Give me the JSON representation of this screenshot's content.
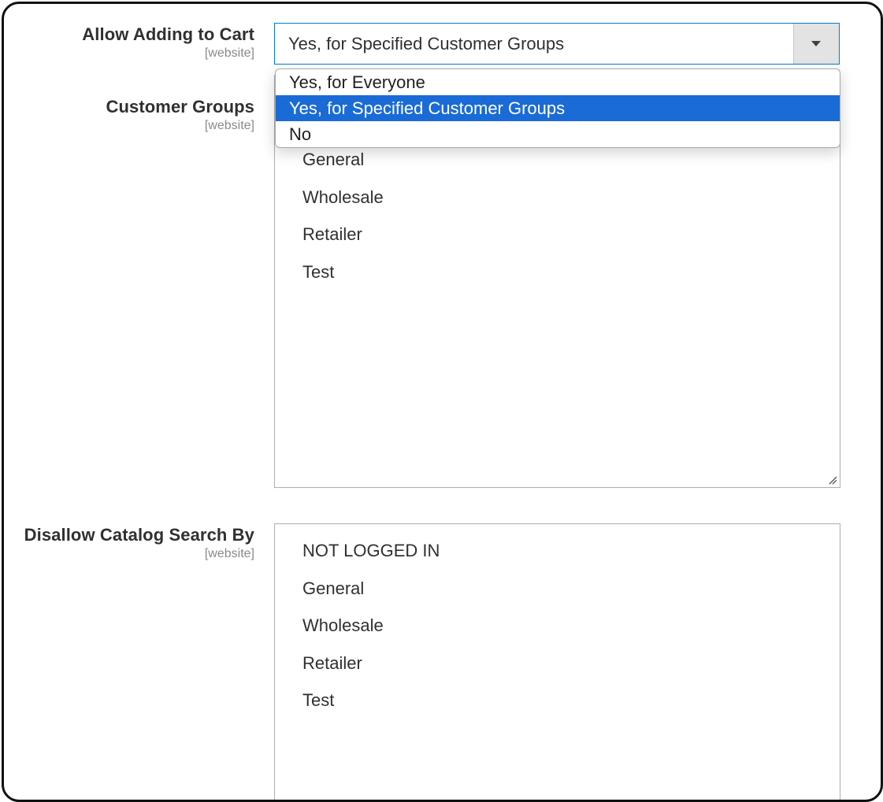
{
  "allow_adding_to_cart": {
    "label": "Allow Adding to Cart",
    "scope": "[website]",
    "selected_value": "Yes, for Specified Customer Groups",
    "options": [
      "Yes, for Everyone",
      "Yes, for Specified Customer Groups",
      "No"
    ]
  },
  "customer_groups": {
    "label": "Customer Groups",
    "scope": "[website]",
    "items": [
      "General",
      "Wholesale",
      "Retailer",
      "Test"
    ]
  },
  "disallow_catalog_search": {
    "label": "Disallow Catalog Search By",
    "scope": "[website]",
    "items": [
      "NOT LOGGED IN",
      "General",
      "Wholesale",
      "Retailer",
      "Test"
    ]
  },
  "colors": {
    "focus_border": "#007bdb",
    "highlight": "#1a6bd6",
    "label_text": "#303030",
    "scope_text": "#8a8a8a"
  },
  "icons": {
    "select_arrow": "caret-down-icon",
    "resize": "resize-grip-icon"
  }
}
